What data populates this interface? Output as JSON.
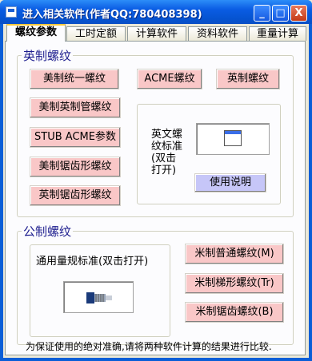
{
  "window": {
    "title": "进入相关软件(作者QQ:780408398)",
    "controls": {
      "minimize": "_",
      "maximize": "□",
      "close": "X"
    }
  },
  "tabs": [
    {
      "label": "螺纹参数",
      "active": true
    },
    {
      "label": "工时定额",
      "active": false
    },
    {
      "label": "计算软件",
      "active": false
    },
    {
      "label": "资料软件",
      "active": false
    },
    {
      "label": "重量计算",
      "active": false
    }
  ],
  "imperial": {
    "group_label": "英制螺纹",
    "buttons": {
      "unified": "美制统一螺纹",
      "acme": "ACME螺纹",
      "british": "英制螺纹",
      "pipe": "美制英制管螺纹",
      "stub_acme": "STUB ACME参数",
      "us_buttress": "美制锯齿形螺纹",
      "uk_buttress": "英制锯齿形螺纹"
    },
    "standard": {
      "label_lines": [
        "英文螺",
        "纹标准",
        "(双击",
        "打开)"
      ],
      "help_button": "使用说明"
    }
  },
  "metric": {
    "group_label": "公制螺纹",
    "gauge_label": "通用量规标准(双击打开)",
    "buttons": {
      "normal": "米制普通螺纹(M)",
      "trapezoid": "米制梯形螺纹(Tr)",
      "buttress": "米制锯齿螺纹(B)"
    }
  },
  "footer": "为保证使用的绝对准确,请将两种软件计算的结果进行比较."
}
